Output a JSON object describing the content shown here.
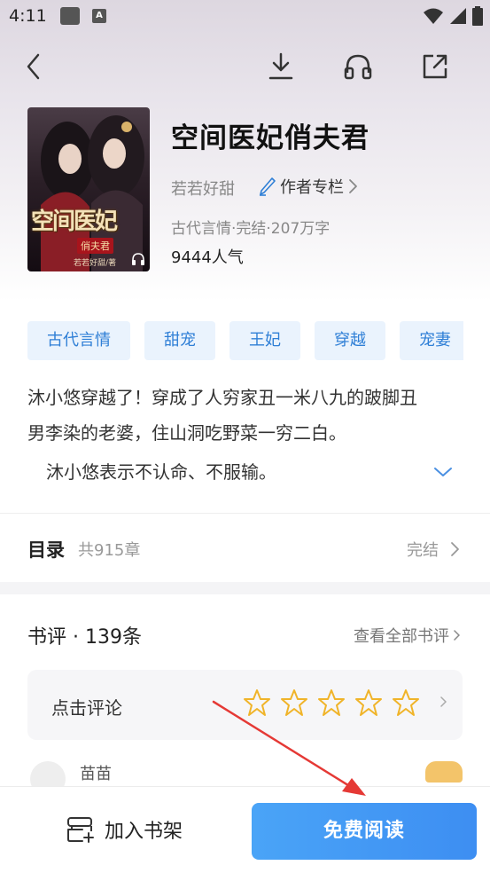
{
  "status_bar": {
    "time": "4:11",
    "a_glyph": "A"
  },
  "nav": {
    "back_icon": "back-arrow-icon",
    "download_icon": "download-icon",
    "listen_icon": "headphones-icon",
    "share_icon": "share-icon"
  },
  "book": {
    "title": "空间医妃俏夫君",
    "author": "若若好甜",
    "author_column": "作者专栏",
    "meta": "古代言情·完结·207万字",
    "popularity": "9444人气",
    "cover": {
      "title_art": "空间医妃",
      "subtitle_art": "俏夫君",
      "signature": "若若好甜/著"
    }
  },
  "tags": [
    "古代言情",
    "甜宠",
    "王妃",
    "穿越",
    "宠妻"
  ],
  "description": {
    "line1": "沐小悠穿越了！穿成了人穷家丑一米八九的跛脚丑",
    "line2": "男李染的老婆，住山洞吃野菜一穷二白。",
    "line3": "沐小悠表示不认命、不服输。"
  },
  "catalog": {
    "label": "目录",
    "count": "共915章",
    "status": "完结"
  },
  "reviews": {
    "title": "书评 · 139条",
    "view_all": "查看全部书评",
    "rate_prompt": "点击评论",
    "star_count": 5,
    "peek_name": "苗苗"
  },
  "bottom": {
    "shelf_label": "加入书架",
    "read_label": "免费阅读"
  },
  "colors": {
    "accent_blue": "#2f7fd6",
    "tag_bg": "#eaf3fd",
    "star": "#f0b429",
    "read_button": "#4aa4f7",
    "annotation_arrow": "#e53935"
  }
}
